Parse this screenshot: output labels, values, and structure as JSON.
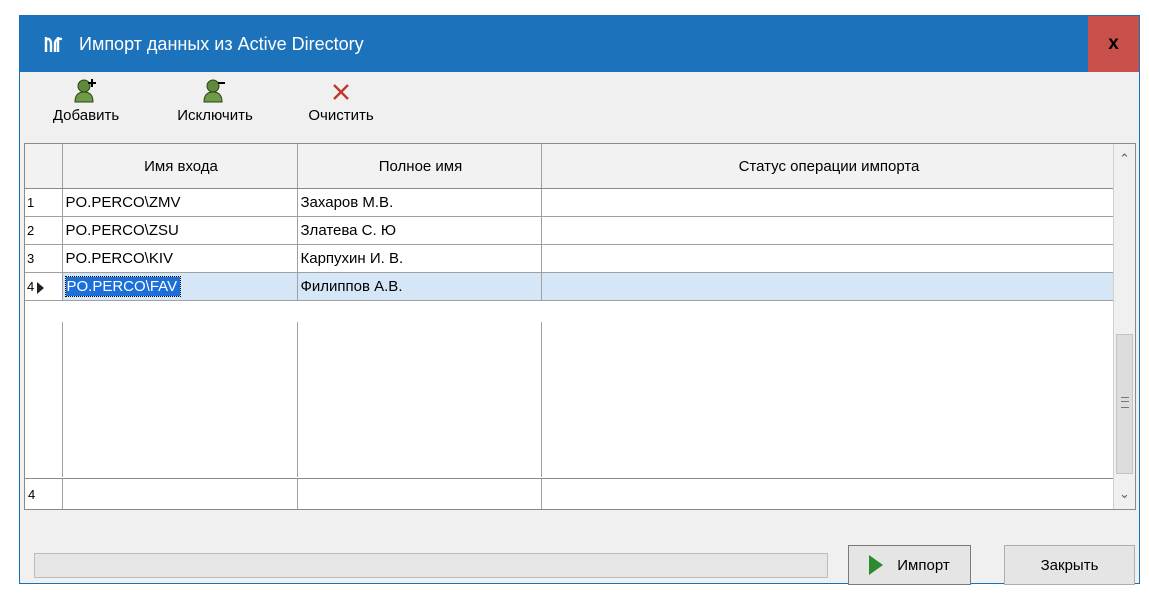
{
  "window": {
    "title": "Импорт данных из Active Directory",
    "close_label": "x"
  },
  "toolbar": {
    "add_label": "Добавить",
    "exclude_label": "Исключить",
    "clear_label": "Очистить"
  },
  "grid": {
    "columns": [
      "Имя входа",
      "Полное имя",
      "Статус операции импорта"
    ],
    "rows": [
      {
        "num": "1",
        "login": "PO.PERCO\\ZMV",
        "full_name": "Захаров М.В.",
        "status": ""
      },
      {
        "num": "2",
        "login": "PO.PERCO\\ZSU",
        "full_name": "Златева С. Ю",
        "status": ""
      },
      {
        "num": "3",
        "login": "PO.PERCO\\KIV",
        "full_name": "Карпухин И. В.",
        "status": ""
      },
      {
        "num": "4",
        "login": "PO.PERCO\\FAV",
        "full_name": "Филиппов А.В.",
        "status": ""
      }
    ],
    "footer_count": "4"
  },
  "footer": {
    "import_label": "Импорт",
    "close_label": "Закрыть"
  },
  "colors": {
    "titlebar": "#1c73bb",
    "close": "#c7504a",
    "selection": "#1c6fd8",
    "play": "#2e8a2e"
  }
}
